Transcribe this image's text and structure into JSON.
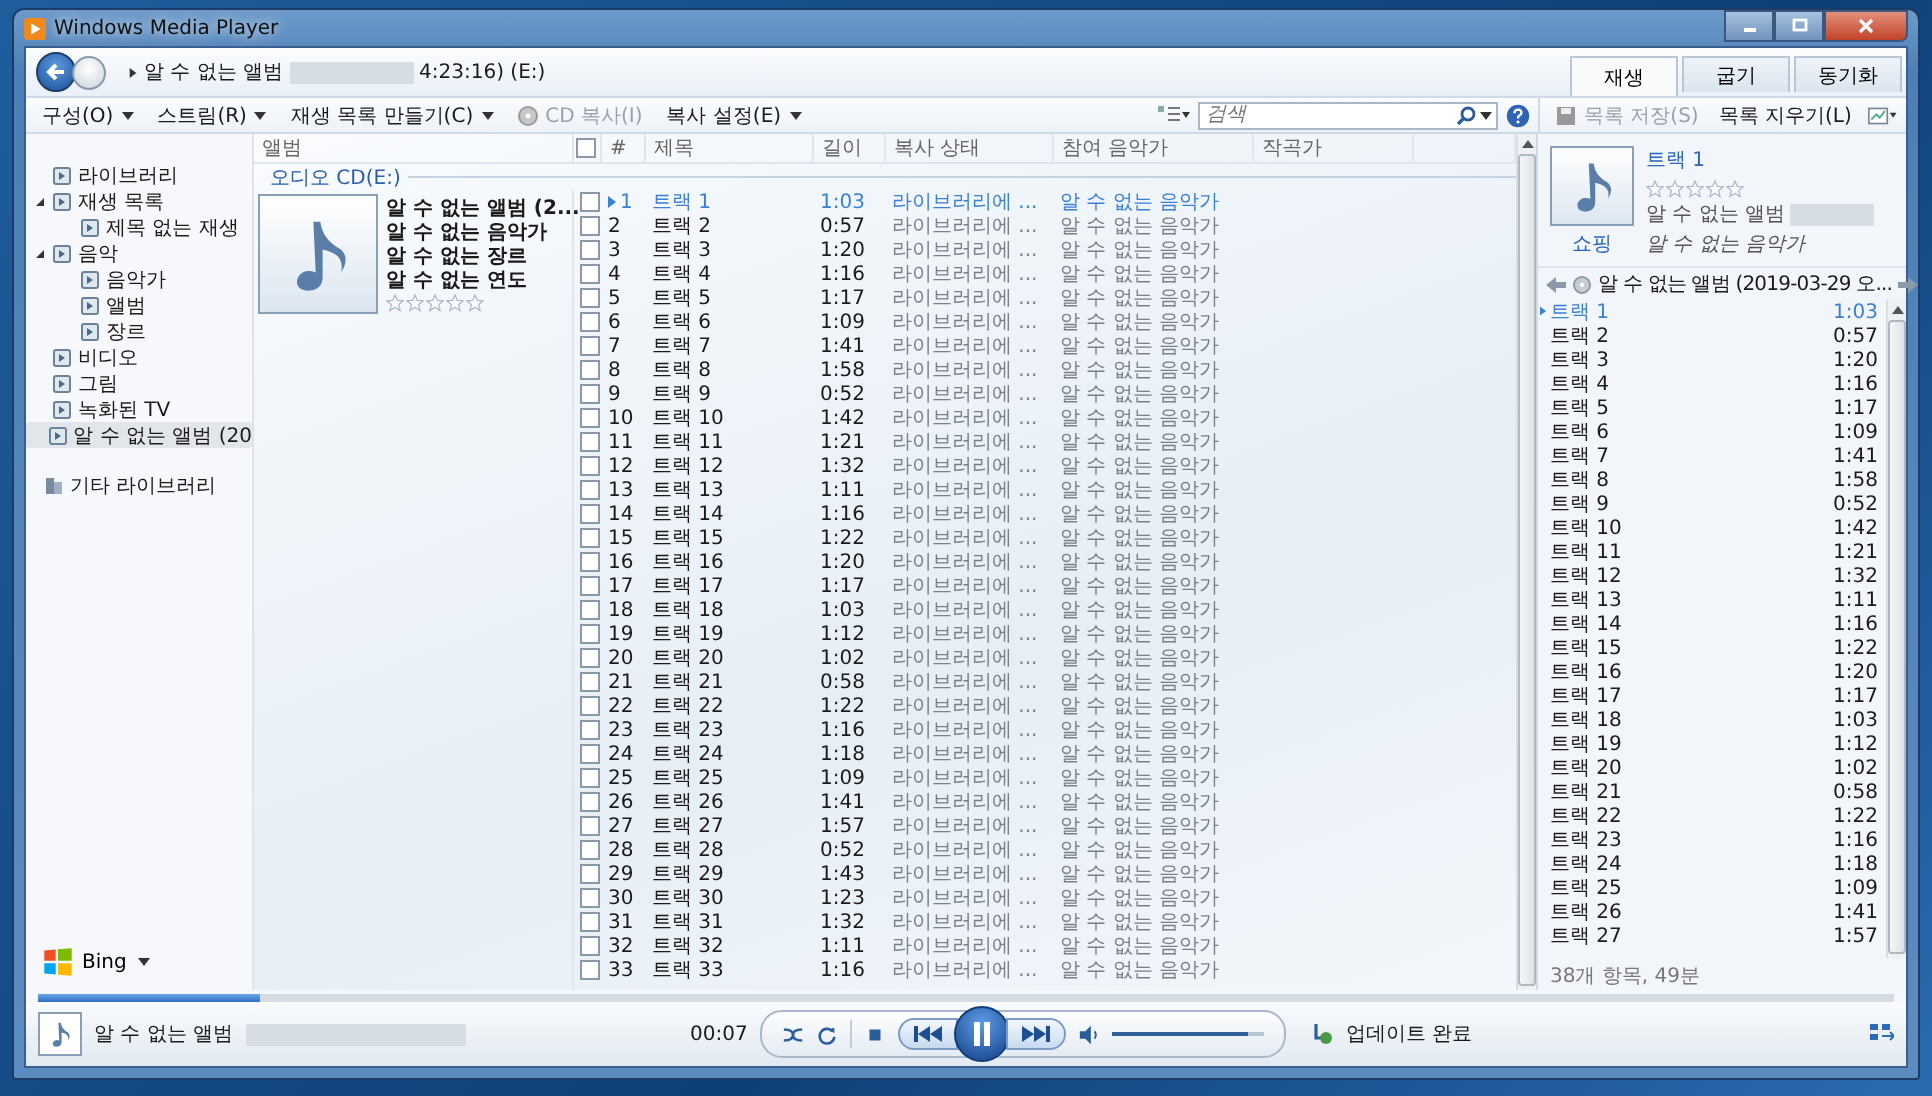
{
  "window": {
    "title": "Windows Media Player"
  },
  "breadcrumb": {
    "album": "알 수 없는 앨범",
    "redacted": true,
    "tail": "4:23:16) (E:)"
  },
  "tabs": [
    {
      "label": "재생",
      "selected": true
    },
    {
      "label": "굽기",
      "selected": false
    },
    {
      "label": "동기화",
      "selected": false
    }
  ],
  "toolbar": {
    "menus": [
      {
        "label": "구성(O)",
        "kind": "menu",
        "disabled": false
      },
      {
        "label": "스트림(R)",
        "kind": "menu",
        "disabled": false
      },
      {
        "label": "재생 목록 만들기(C)",
        "kind": "menu",
        "disabled": false
      },
      {
        "label": "CD 복사(I)",
        "kind": "rip",
        "disabled": true
      },
      {
        "label": "복사 설정(E)",
        "kind": "menu",
        "disabled": false
      }
    ],
    "search": {
      "placeholder": "검색"
    }
  },
  "sidebar": {
    "items": [
      {
        "label": "라이브러리",
        "selected": false
      },
      {
        "label": "재생 목록",
        "selected": false,
        "expanded": true,
        "children": [
          {
            "label": "제목 없는 재생",
            "selected": false
          }
        ]
      },
      {
        "label": "음악",
        "selected": false,
        "expanded": true,
        "children": [
          {
            "label": "음악가",
            "selected": false
          },
          {
            "label": "앨범",
            "selected": false
          },
          {
            "label": "장르",
            "selected": false
          }
        ]
      },
      {
        "label": "비디오",
        "selected": false
      },
      {
        "label": "그림",
        "selected": false
      },
      {
        "label": "녹화된 TV",
        "selected": false
      },
      {
        "label": "알 수 없는 앨범 (20",
        "selected": true
      }
    ],
    "other": "기타 라이브러리",
    "bing": "Bing"
  },
  "library": {
    "columns": [
      "앨범",
      "#",
      "제목",
      "길이",
      "복사 상태",
      "참여 음악가",
      "작곡가"
    ],
    "select_all_checked": false,
    "group": "오디오 CD(E:)",
    "album": {
      "lines": [
        "알 수 없는 앨범 (2...",
        "알 수 없는 음악가",
        "알 수 없는 장르",
        "알 수 없는 연도"
      ],
      "stars": 0
    },
    "rows": [
      {
        "checked": false,
        "playing": true,
        "number": "1",
        "title": "트랙 1",
        "length": "1:03",
        "rip_status": "라이브러리에 ...",
        "artist": "알 수 없는 음악가"
      },
      {
        "checked": false,
        "playing": false,
        "number": "2",
        "title": "트랙 2",
        "length": "0:57",
        "rip_status": "라이브러리에 ...",
        "artist": "알 수 없는 음악가"
      },
      {
        "checked": false,
        "playing": false,
        "number": "3",
        "title": "트랙 3",
        "length": "1:20",
        "rip_status": "라이브러리에 ...",
        "artist": "알 수 없는 음악가"
      },
      {
        "checked": false,
        "playing": false,
        "number": "4",
        "title": "트랙 4",
        "length": "1:16",
        "rip_status": "라이브러리에 ...",
        "artist": "알 수 없는 음악가"
      },
      {
        "checked": false,
        "playing": false,
        "number": "5",
        "title": "트랙 5",
        "length": "1:17",
        "rip_status": "라이브러리에 ...",
        "artist": "알 수 없는 음악가"
      },
      {
        "checked": false,
        "playing": false,
        "number": "6",
        "title": "트랙 6",
        "length": "1:09",
        "rip_status": "라이브러리에 ...",
        "artist": "알 수 없는 음악가"
      },
      {
        "checked": false,
        "playing": false,
        "number": "7",
        "title": "트랙 7",
        "length": "1:41",
        "rip_status": "라이브러리에 ...",
        "artist": "알 수 없는 음악가"
      },
      {
        "checked": false,
        "playing": false,
        "number": "8",
        "title": "트랙 8",
        "length": "1:58",
        "rip_status": "라이브러리에 ...",
        "artist": "알 수 없는 음악가"
      },
      {
        "checked": false,
        "playing": false,
        "number": "9",
        "title": "트랙 9",
        "length": "0:52",
        "rip_status": "라이브러리에 ...",
        "artist": "알 수 없는 음악가"
      },
      {
        "checked": false,
        "playing": false,
        "number": "10",
        "title": "트랙 10",
        "length": "1:42",
        "rip_status": "라이브러리에 ...",
        "artist": "알 수 없는 음악가"
      },
      {
        "checked": false,
        "playing": false,
        "number": "11",
        "title": "트랙 11",
        "length": "1:21",
        "rip_status": "라이브러리에 ...",
        "artist": "알 수 없는 음악가"
      },
      {
        "checked": false,
        "playing": false,
        "number": "12",
        "title": "트랙 12",
        "length": "1:32",
        "rip_status": "라이브러리에 ...",
        "artist": "알 수 없는 음악가"
      },
      {
        "checked": false,
        "playing": false,
        "number": "13",
        "title": "트랙 13",
        "length": "1:11",
        "rip_status": "라이브러리에 ...",
        "artist": "알 수 없는 음악가"
      },
      {
        "checked": false,
        "playing": false,
        "number": "14",
        "title": "트랙 14",
        "length": "1:16",
        "rip_status": "라이브러리에 ...",
        "artist": "알 수 없는 음악가"
      },
      {
        "checked": false,
        "playing": false,
        "number": "15",
        "title": "트랙 15",
        "length": "1:22",
        "rip_status": "라이브러리에 ...",
        "artist": "알 수 없는 음악가"
      },
      {
        "checked": false,
        "playing": false,
        "number": "16",
        "title": "트랙 16",
        "length": "1:20",
        "rip_status": "라이브러리에 ...",
        "artist": "알 수 없는 음악가"
      },
      {
        "checked": false,
        "playing": false,
        "number": "17",
        "title": "트랙 17",
        "length": "1:17",
        "rip_status": "라이브러리에 ...",
        "artist": "알 수 없는 음악가"
      },
      {
        "checked": false,
        "playing": false,
        "number": "18",
        "title": "트랙 18",
        "length": "1:03",
        "rip_status": "라이브러리에 ...",
        "artist": "알 수 없는 음악가"
      },
      {
        "checked": false,
        "playing": false,
        "number": "19",
        "title": "트랙 19",
        "length": "1:12",
        "rip_status": "라이브러리에 ...",
        "artist": "알 수 없는 음악가"
      },
      {
        "checked": false,
        "playing": false,
        "number": "20",
        "title": "트랙 20",
        "length": "1:02",
        "rip_status": "라이브러리에 ...",
        "artist": "알 수 없는 음악가"
      },
      {
        "checked": false,
        "playing": false,
        "number": "21",
        "title": "트랙 21",
        "length": "0:58",
        "rip_status": "라이브러리에 ...",
        "artist": "알 수 없는 음악가"
      },
      {
        "checked": false,
        "playing": false,
        "number": "22",
        "title": "트랙 22",
        "length": "1:22",
        "rip_status": "라이브러리에 ...",
        "artist": "알 수 없는 음악가"
      },
      {
        "checked": false,
        "playing": false,
        "number": "23",
        "title": "트랙 23",
        "length": "1:16",
        "rip_status": "라이브러리에 ...",
        "artist": "알 수 없는 음악가"
      },
      {
        "checked": false,
        "playing": false,
        "number": "24",
        "title": "트랙 24",
        "length": "1:18",
        "rip_status": "라이브러리에 ...",
        "artist": "알 수 없는 음악가"
      },
      {
        "checked": false,
        "playing": false,
        "number": "25",
        "title": "트랙 25",
        "length": "1:09",
        "rip_status": "라이브러리에 ...",
        "artist": "알 수 없는 음악가"
      },
      {
        "checked": false,
        "playing": false,
        "number": "26",
        "title": "트랙 26",
        "length": "1:41",
        "rip_status": "라이브러리에 ...",
        "artist": "알 수 없는 음악가"
      },
      {
        "checked": false,
        "playing": false,
        "number": "27",
        "title": "트랙 27",
        "length": "1:57",
        "rip_status": "라이브러리에 ...",
        "artist": "알 수 없는 음악가"
      },
      {
        "checked": false,
        "playing": false,
        "number": "28",
        "title": "트랙 28",
        "length": "0:52",
        "rip_status": "라이브러리에 ...",
        "artist": "알 수 없는 음악가"
      },
      {
        "checked": false,
        "playing": false,
        "number": "29",
        "title": "트랙 29",
        "length": "1:43",
        "rip_status": "라이브러리에 ...",
        "artist": "알 수 없는 음악가"
      },
      {
        "checked": false,
        "playing": false,
        "number": "30",
        "title": "트랙 30",
        "length": "1:23",
        "rip_status": "라이브러리에 ...",
        "artist": "알 수 없는 음악가"
      },
      {
        "checked": false,
        "playing": false,
        "number": "31",
        "title": "트랙 31",
        "length": "1:32",
        "rip_status": "라이브러리에 ...",
        "artist": "알 수 없는 음악가"
      },
      {
        "checked": false,
        "playing": false,
        "number": "32",
        "title": "트랙 32",
        "length": "1:11",
        "rip_status": "라이브러리에 ...",
        "artist": "알 수 없는 음악가"
      },
      {
        "checked": false,
        "playing": false,
        "number": "33",
        "title": "트랙 33",
        "length": "1:16",
        "rip_status": "라이브러리에 ...",
        "artist": "알 수 없는 음악가"
      }
    ]
  },
  "playlist_panel": {
    "actions": [
      {
        "label": "목록 저장(S)",
        "disabled": true
      },
      {
        "label": "목록 지우기(L)",
        "disabled": false
      }
    ],
    "now_playing": {
      "title": "트랙 1",
      "stars": 0,
      "album": "알 수 없는 앨범",
      "album_redacted": true,
      "artist": "알 수 없는 음악가",
      "shop": "쇼핑"
    },
    "list_title": "알 수 없는 앨범 (2019-03-29 오...",
    "items": [
      {
        "title": "트랙 1",
        "length": "1:03",
        "playing": true
      },
      {
        "title": "트랙 2",
        "length": "0:57",
        "playing": false
      },
      {
        "title": "트랙 3",
        "length": "1:20",
        "playing": false
      },
      {
        "title": "트랙 4",
        "length": "1:16",
        "playing": false
      },
      {
        "title": "트랙 5",
        "length": "1:17",
        "playing": false
      },
      {
        "title": "트랙 6",
        "length": "1:09",
        "playing": false
      },
      {
        "title": "트랙 7",
        "length": "1:41",
        "playing": false
      },
      {
        "title": "트랙 8",
        "length": "1:58",
        "playing": false
      },
      {
        "title": "트랙 9",
        "length": "0:52",
        "playing": false
      },
      {
        "title": "트랙 10",
        "length": "1:42",
        "playing": false
      },
      {
        "title": "트랙 11",
        "length": "1:21",
        "playing": false
      },
      {
        "title": "트랙 12",
        "length": "1:32",
        "playing": false
      },
      {
        "title": "트랙 13",
        "length": "1:11",
        "playing": false
      },
      {
        "title": "트랙 14",
        "length": "1:16",
        "playing": false
      },
      {
        "title": "트랙 15",
        "length": "1:22",
        "playing": false
      },
      {
        "title": "트랙 16",
        "length": "1:20",
        "playing": false
      },
      {
        "title": "트랙 17",
        "length": "1:17",
        "playing": false
      },
      {
        "title": "트랙 18",
        "length": "1:03",
        "playing": false
      },
      {
        "title": "트랙 19",
        "length": "1:12",
        "playing": false
      },
      {
        "title": "트랙 20",
        "length": "1:02",
        "playing": false
      },
      {
        "title": "트랙 21",
        "length": "0:58",
        "playing": false
      },
      {
        "title": "트랙 22",
        "length": "1:22",
        "playing": false
      },
      {
        "title": "트랙 23",
        "length": "1:16",
        "playing": false
      },
      {
        "title": "트랙 24",
        "length": "1:18",
        "playing": false
      },
      {
        "title": "트랙 25",
        "length": "1:09",
        "playing": false
      },
      {
        "title": "트랙 26",
        "length": "1:41",
        "playing": false
      },
      {
        "title": "트랙 27",
        "length": "1:57",
        "playing": false
      }
    ],
    "summary": "38개 항목, 49분"
  },
  "player": {
    "title": "알 수 없는 앨범",
    "title_redacted": true,
    "seek": {
      "level": 0.12
    },
    "time": "00:07",
    "playing": true,
    "volume": {
      "level": 0.9
    },
    "status": "업데이트 완료"
  }
}
